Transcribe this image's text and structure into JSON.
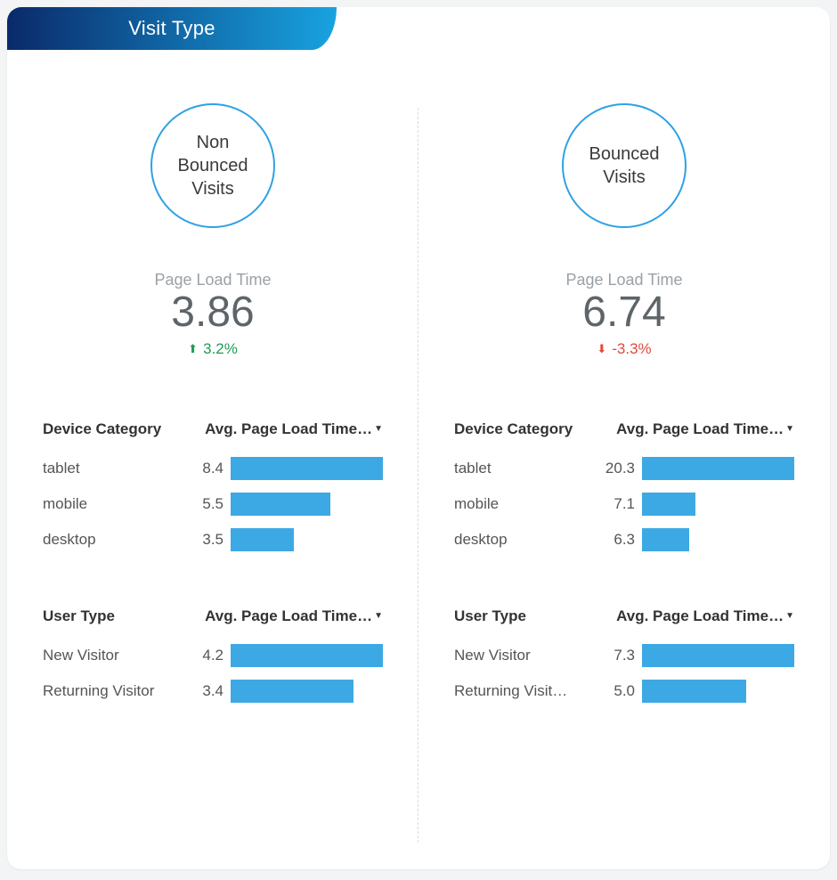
{
  "tab_title": "Visit Type",
  "panels": [
    {
      "circle_label": "Non Bounced Visits",
      "metric_label": "Page Load Time",
      "metric_value": "3.86",
      "delta_dir": "up",
      "delta_text": "3.2%",
      "tables": [
        {
          "group_header": "Device Category",
          "value_header": "Avg. Page Load Time…",
          "max": 8.4,
          "rows": [
            {
              "label": "tablet",
              "value": "8.4",
              "num": 8.4
            },
            {
              "label": "mobile",
              "value": "5.5",
              "num": 5.5
            },
            {
              "label": "desktop",
              "value": "3.5",
              "num": 3.5
            }
          ]
        },
        {
          "group_header": "User Type",
          "value_header": "Avg. Page Load Time…",
          "max": 4.2,
          "rows": [
            {
              "label": "New Visitor",
              "value": "4.2",
              "num": 4.2
            },
            {
              "label": "Returning Visitor",
              "value": "3.4",
              "num": 3.4
            }
          ]
        }
      ]
    },
    {
      "circle_label": "Bounced Visits",
      "metric_label": "Page Load Time",
      "metric_value": "6.74",
      "delta_dir": "down",
      "delta_text": "-3.3%",
      "tables": [
        {
          "group_header": "Device Category",
          "value_header": "Avg. Page Load Time…",
          "max": 20.3,
          "rows": [
            {
              "label": "tablet",
              "value": "20.3",
              "num": 20.3
            },
            {
              "label": "mobile",
              "value": "7.1",
              "num": 7.1
            },
            {
              "label": "desktop",
              "value": "6.3",
              "num": 6.3
            }
          ]
        },
        {
          "group_header": "User Type",
          "value_header": "Avg. Page Load Time…",
          "max": 7.3,
          "rows": [
            {
              "label": "New Visitor",
              "value": "7.3",
              "num": 7.3
            },
            {
              "label": "Returning Visit…",
              "value": "5.0",
              "num": 5.0
            }
          ]
        }
      ]
    }
  ],
  "chart_data": [
    {
      "type": "bar",
      "title": "Non Bounced Visits — Avg. Page Load Time by Device Category",
      "categories": [
        "tablet",
        "mobile",
        "desktop"
      ],
      "values": [
        8.4,
        5.5,
        3.5
      ],
      "xlabel": "Device Category",
      "ylabel": "Avg. Page Load Time",
      "ylim": [
        0,
        8.4
      ]
    },
    {
      "type": "bar",
      "title": "Non Bounced Visits — Avg. Page Load Time by User Type",
      "categories": [
        "New Visitor",
        "Returning Visitor"
      ],
      "values": [
        4.2,
        3.4
      ],
      "xlabel": "User Type",
      "ylabel": "Avg. Page Load Time",
      "ylim": [
        0,
        4.2
      ]
    },
    {
      "type": "bar",
      "title": "Bounced Visits — Avg. Page Load Time by Device Category",
      "categories": [
        "tablet",
        "mobile",
        "desktop"
      ],
      "values": [
        20.3,
        7.1,
        6.3
      ],
      "xlabel": "Device Category",
      "ylabel": "Avg. Page Load Time",
      "ylim": [
        0,
        20.3
      ]
    },
    {
      "type": "bar",
      "title": "Bounced Visits — Avg. Page Load Time by User Type",
      "categories": [
        "New Visitor",
        "Returning Visitor"
      ],
      "values": [
        7.3,
        5.0
      ],
      "xlabel": "User Type",
      "ylabel": "Avg. Page Load Time",
      "ylim": [
        0,
        7.3
      ]
    }
  ]
}
